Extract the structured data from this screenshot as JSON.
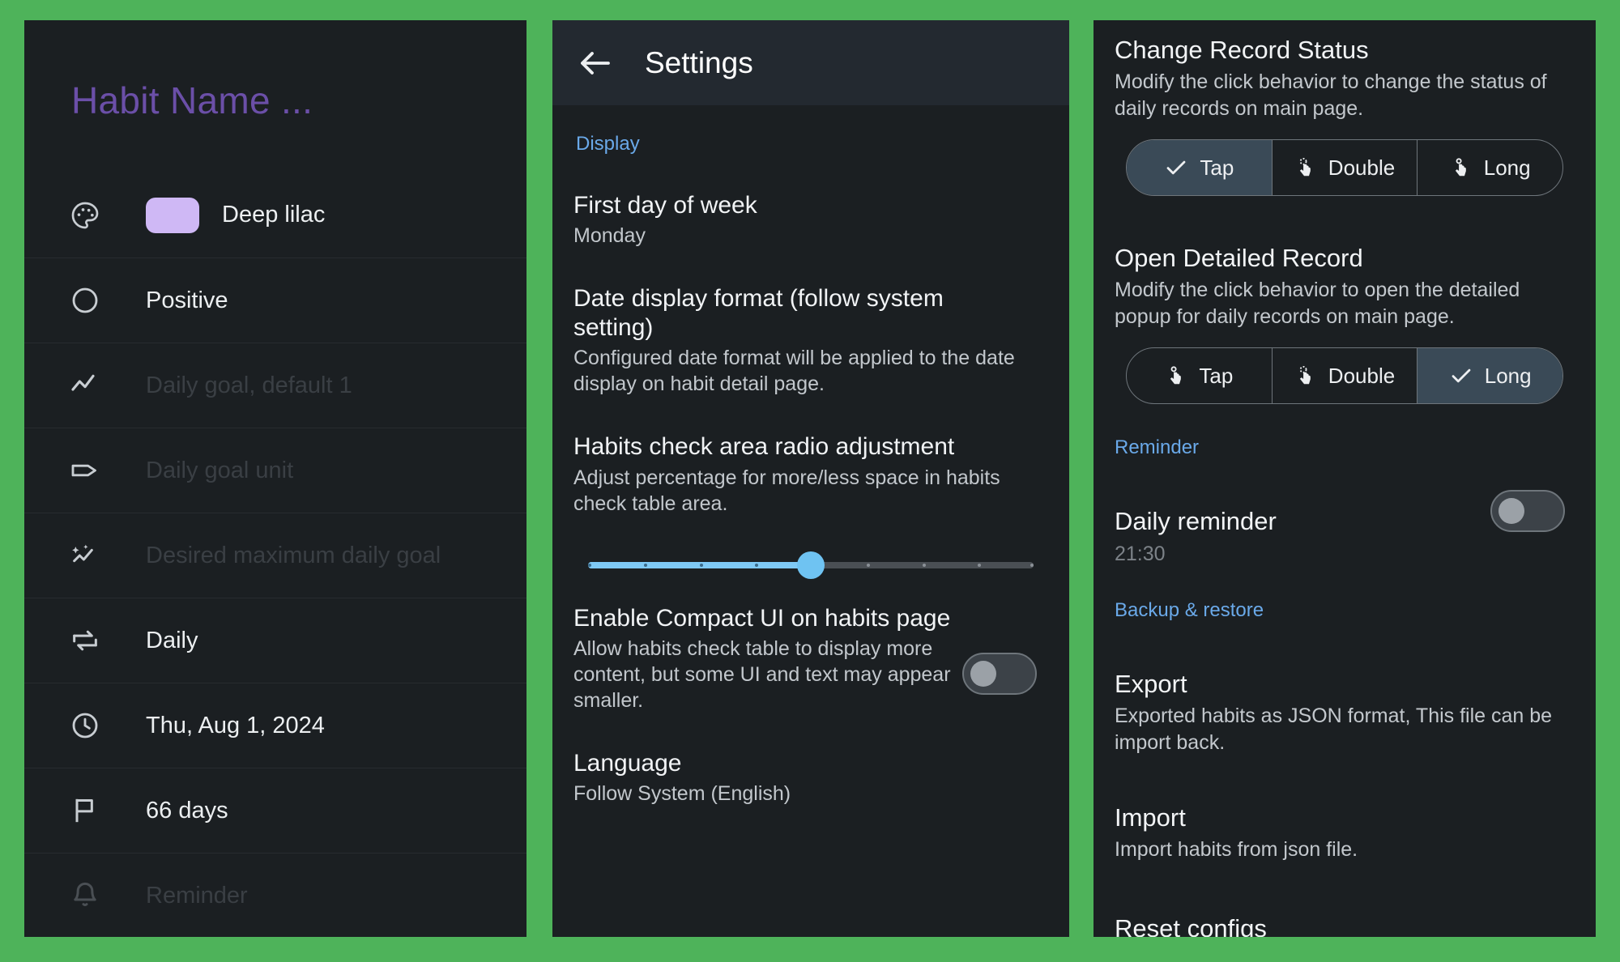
{
  "background_color": "#4EB35A",
  "panel_background": "#1B1F22",
  "accent_color": "#6AA9E9",
  "slider_color": "#7FC9F5",
  "habit_detail": {
    "title": "Habit Name ...",
    "rows": [
      {
        "icon": "palette-icon",
        "type": "color",
        "swatch_color": "#CFB8F5",
        "label": "Deep lilac",
        "placeholder": false
      },
      {
        "icon": "circle-icon",
        "type": "text",
        "label": "Positive",
        "placeholder": false
      },
      {
        "icon": "trend-line-icon",
        "type": "text",
        "label": "Daily goal, default 1",
        "placeholder": true
      },
      {
        "icon": "tag-icon",
        "type": "text",
        "label": "Daily goal unit",
        "placeholder": true
      },
      {
        "icon": "sparkle-chart-icon",
        "type": "text",
        "label": "Desired maximum daily goal",
        "placeholder": true
      },
      {
        "icon": "repeat-icon",
        "type": "text",
        "label": "Daily",
        "placeholder": false
      },
      {
        "icon": "clock-icon",
        "type": "text",
        "label": "Thu, Aug 1, 2024",
        "placeholder": false
      },
      {
        "icon": "flag-icon",
        "type": "text",
        "label": "66 days",
        "placeholder": false
      },
      {
        "icon": "bell-icon",
        "type": "text",
        "label": "Reminder",
        "placeholder": true
      }
    ]
  },
  "settings": {
    "appbar": {
      "back_label": "back-arrow",
      "title": "Settings"
    },
    "display_section": "Display",
    "first_day": {
      "title": "First day of week",
      "value": "Monday"
    },
    "date_format": {
      "title": "Date display format (follow system setting)",
      "sub": "Configured date format will be applied to the date display on habit detail page."
    },
    "radio_adjustment": {
      "title": "Habits check area radio adjustment",
      "sub": "Adjust percentage for more/less space in habits check table area.",
      "slider": {
        "value": 50,
        "min": 0,
        "max": 100,
        "ticks": 9
      }
    },
    "compact_ui": {
      "title": "Enable Compact UI on habits page",
      "sub": "Allow habits check table to display more content, but some UI and text may appear smaller.",
      "enabled": false
    },
    "language": {
      "title": "Language",
      "value": "Follow System (English)"
    }
  },
  "settings_right": {
    "change_record_status": {
      "title": "Change Record Status",
      "sub": "Modify the click behavior to change the status of daily records on main page.",
      "options": [
        {
          "label": "Tap",
          "icon": "check-icon",
          "selected": true
        },
        {
          "label": "Double",
          "icon": "double-tap-icon",
          "selected": false
        },
        {
          "label": "Long",
          "icon": "long-press-icon",
          "selected": false
        }
      ]
    },
    "open_detailed_record": {
      "title": "Open Detailed Record",
      "sub": "Modify the click behavior to open the detailed popup for daily records on main page.",
      "options": [
        {
          "label": "Tap",
          "icon": "tap-icon",
          "selected": false
        },
        {
          "label": "Double",
          "icon": "double-tap-icon",
          "selected": false
        },
        {
          "label": "Long",
          "icon": "check-icon",
          "selected": true
        }
      ]
    },
    "reminder_section": "Reminder",
    "daily_reminder": {
      "title": "Daily reminder",
      "time": "21:30",
      "enabled": false
    },
    "backup_section": "Backup & restore",
    "export": {
      "title": "Export",
      "sub": "Exported habits as JSON format, This file can be import back."
    },
    "import": {
      "title": "Import",
      "sub": "Import habits from json file."
    },
    "reset": {
      "title": "Reset configs"
    }
  }
}
